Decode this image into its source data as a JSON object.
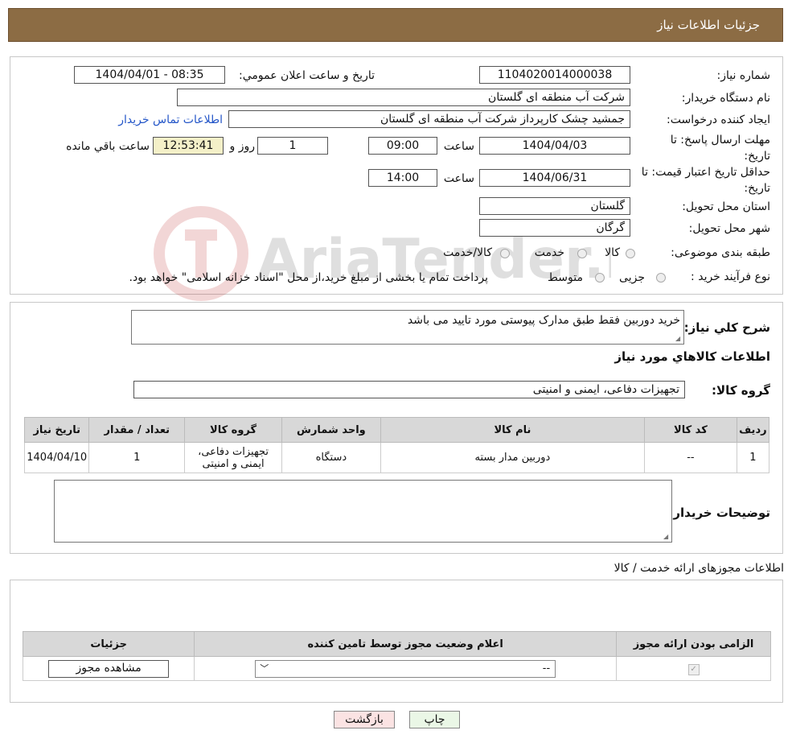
{
  "header": {
    "title": "جزئیات اطلاعات نیاز"
  },
  "fields": {
    "need_number_label": "شماره نیاز:",
    "need_number": "1104020014000038",
    "announce_label": "تاریخ و ساعت اعلان عمومي:",
    "announce_value": "1404/04/01 - 08:35",
    "buyer_org_label": "نام دستگاه خريدار:",
    "buyer_org": "شرکت آب منطقه ای گلستان",
    "requester_label": "ایجاد کننده درخواست:",
    "requester": "جمشید چشک کارپرداز شرکت آب منطقه ای گلستان",
    "contact_link": "اطلاعات تماس خریدار",
    "deadline_label": "مهلت ارسال پاسخ: تا تاریخ:",
    "deadline_date": "1404/04/03",
    "time_label": "ساعت",
    "deadline_time": "09:00",
    "days_value": "1",
    "days_label": "روز و",
    "remaining_time": "12:53:41",
    "remaining_label": "ساعت باقي مانده",
    "price_validity_label": "حداقل تاریخ اعتبار قیمت: تا تاریخ:",
    "price_validity_date": "1404/06/31",
    "price_validity_time": "14:00",
    "province_label": "استان محل تحویل:",
    "province": "گلستان",
    "city_label": "شهر محل تحویل:",
    "city": "گرگان",
    "category_label": "طبقه بندی موضوعی:",
    "category_options": [
      "کالا",
      "خدمت",
      "کالا/خدمت"
    ],
    "process_label": "نوع فرآیند خرید :",
    "process_options": [
      "جزیی",
      "متوسط"
    ],
    "process_note": "پرداخت تمام یا بخشی از مبلغ خرید،از محل \"اسناد خزانه اسلامی\" خواهد بود."
  },
  "watermark": {
    "text": "AriaTender.neT"
  },
  "summary": {
    "label": "شرح کلي نياز:",
    "value": "خرید دوربین فقط طبق مدارک پیوستی مورد تایید می باشد",
    "goods_section": "اطلاعات کالاهاي مورد نياز",
    "group_label": "گروه کالا:",
    "group_value": "تجهیزات دفاعی، ایمنی و امنیتی"
  },
  "goods_table": {
    "headers": [
      "رديف",
      "کد کالا",
      "نام کالا",
      "واحد شمارش",
      "گروه کالا",
      "تعداد / مقدار",
      "تاريخ نياز"
    ],
    "rows": [
      [
        "1",
        "--",
        "دوربین مدار بسته",
        "دستگاه",
        "تجهیزات دفاعی، ایمنی و امنیتی",
        "1",
        "1404/04/10"
      ]
    ]
  },
  "buyer_notes": {
    "label": "توضيحات خريدار:",
    "value": ""
  },
  "permits": {
    "title": "اطلاعات مجوزهای ارائه خدمت / کالا",
    "headers": [
      "الزامی بودن ارائه مجوز",
      "اعلام وضعیت مجوز توسط تامین کننده",
      "جزئیات"
    ],
    "select_value": "--",
    "view_button": "مشاهده مجوز"
  },
  "buttons": {
    "print": "چاپ",
    "back": "بازگشت"
  }
}
